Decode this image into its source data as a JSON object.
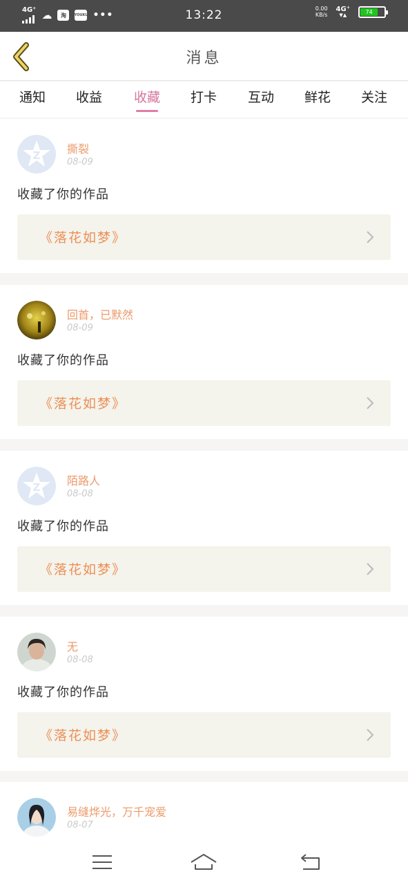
{
  "status_bar": {
    "network_left": "4G⁺",
    "app_icons": [
      "cloud-icon",
      "taobao-icon",
      "youku-icon"
    ],
    "taobao_label": "淘",
    "youku_label": "YOUKU",
    "dots": "•••",
    "time": "13:22",
    "speed_value": "0.00",
    "speed_unit": "KB/s",
    "network_right": "4G⁺",
    "battery_level": "74",
    "battery_color": "#1fc51f"
  },
  "header": {
    "title": "消息"
  },
  "tabs": [
    {
      "label": "通知"
    },
    {
      "label": "收益"
    },
    {
      "label": "收藏"
    },
    {
      "label": "打卡"
    },
    {
      "label": "互动"
    },
    {
      "label": "鲜花"
    },
    {
      "label": "关注"
    }
  ],
  "active_tab": "收藏",
  "messages": [
    {
      "user": "撕裂",
      "date": "08-09",
      "text": "收藏了你的作品",
      "work": "《落花如梦》",
      "avatar": "default-avatar-icon"
    },
    {
      "user": "回首，已默然",
      "date": "08-09",
      "text": "收藏了你的作品",
      "work": "《落花如梦》",
      "avatar": "user-photo-avatar"
    },
    {
      "user": "陌路人",
      "date": "08-08",
      "text": "收藏了你的作品",
      "work": "《落花如梦》",
      "avatar": "default-avatar-icon"
    },
    {
      "user": "无",
      "date": "08-08",
      "text": "收藏了你的作品",
      "work": "《落花如梦》",
      "avatar": "user-photo-avatar"
    },
    {
      "user": "易缝烨光，万千宠爱",
      "date": "08-07",
      "text": "",
      "work": "",
      "avatar": "user-photo-avatar"
    }
  ],
  "colors": {
    "accent_pink": "#e07ca6",
    "username_orange": "#ec9a6a",
    "work_orange": "#ec8f56",
    "work_bg": "#f4f3ec"
  },
  "bottom_nav": [
    "menu-icon",
    "home-icon",
    "back-icon"
  ]
}
